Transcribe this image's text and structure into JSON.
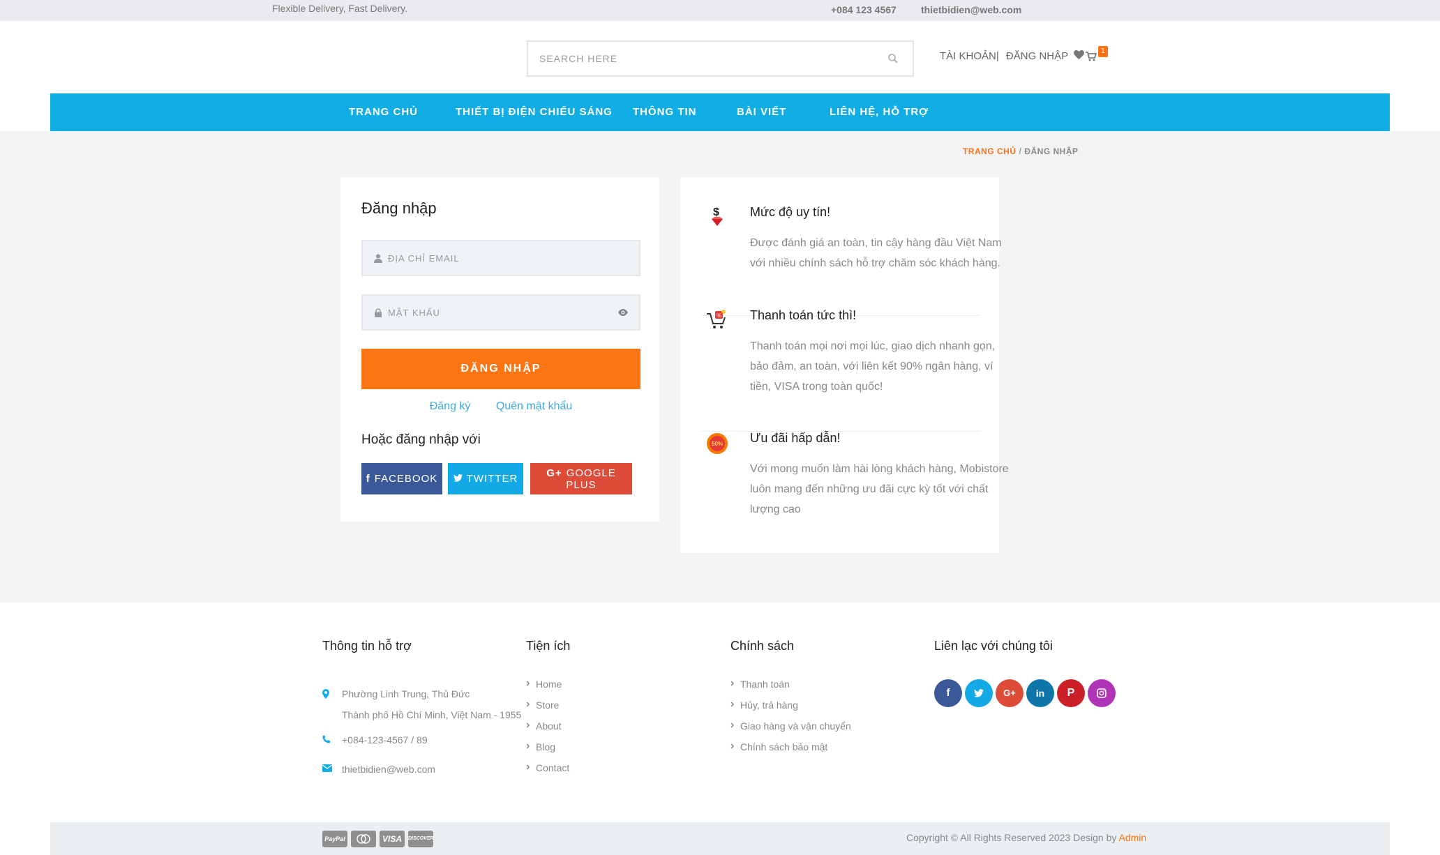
{
  "topbar": {
    "tagline": "Flexible Delivery, Fast Delivery.",
    "phone": "+084 123 4567",
    "email": "thietbidien@web.com"
  },
  "header": {
    "search_placeholder": "SEARCH HERE",
    "account_label": "TÀI KHOẢN|",
    "login_label": "ĐĂNG NHẬP",
    "cart_count": "1"
  },
  "nav": {
    "items": [
      {
        "label": "TRANG CHỦ"
      },
      {
        "label": "THIẾT BỊ ĐIỆN CHIẾU SÁNG"
      },
      {
        "label": "THÔNG TIN"
      },
      {
        "label": "BÀI VIẾT"
      },
      {
        "label": "LIÊN HỆ, HỖ TRỢ"
      }
    ]
  },
  "breadcrumb": {
    "home": "TRANG CHỦ",
    "separator": "/",
    "current": "ĐĂNG NHẬP"
  },
  "login": {
    "title": "Đăng nhập",
    "email_placeholder": "ĐỊA CHỈ EMAIL",
    "password_placeholder": "MẬT KHẨU",
    "submit_label": "ĐĂNG NHẬP",
    "register_link": "Đăng ký",
    "forgot_link": "Quên mật khẩu",
    "or_label": "Hoặc đăng nhập với",
    "facebook_label": "FACEBOOK",
    "twitter_label": "TWITTER",
    "google_label": "GOOGLE PLUS"
  },
  "features": [
    {
      "title": "Mức độ uy tín!",
      "text": "Được đánh giá an toàn, tin cậy hàng đầu Việt Nam với nhiều chính sách hỗ trợ chăm sóc khách hàng."
    },
    {
      "title": "Thanh toán tức thì!",
      "text": "Thanh toán mọi nơi mọi lúc, giao dịch nhanh gọn, bảo đảm, an toàn, với liên kết 90% ngân hàng, ví tiền, VISA trong toàn quốc!"
    },
    {
      "title": "Ưu đãi hấp dẫn!",
      "text": "Với mong muốn làm hài lòng khách hàng, Mobistore luôn mang đến những ưu đãi cực kỳ tốt với chất lượng cao"
    }
  ],
  "footer": {
    "support": {
      "title": "Thông tin hỗ trợ",
      "address_line1": "Phường Linh Trung, Thủ Đức",
      "address_line2": "Thành phố Hồ Chí Minh, Việt Nam - 1955",
      "phone": "+084-123-4567 / 89",
      "email": "thietbidien@web.com"
    },
    "utilities": {
      "title": "Tiện ích",
      "items": [
        "Home",
        "Store",
        "About",
        "Blog",
        "Contact"
      ]
    },
    "policy": {
      "title": "Chính sách",
      "items": [
        "Thanh toán",
        "Hủy, trả hàng",
        "Giao hàng và vận chuyển",
        "Chính sách bảo mật"
      ]
    },
    "connect": {
      "title": "Liên lạc với chúng tôi"
    },
    "copyright": "Copyright © All Rights Reserved 2023 Design by",
    "author": "Admin",
    "payments": [
      "PayPal",
      "Mastercard",
      "VISA",
      "DISCOVER"
    ]
  },
  "colors": {
    "nav": "#10ace4",
    "accent": "#fb7512",
    "facebook": "#3b5998",
    "twitter": "#13a8e6",
    "google": "#dd4b39"
  }
}
